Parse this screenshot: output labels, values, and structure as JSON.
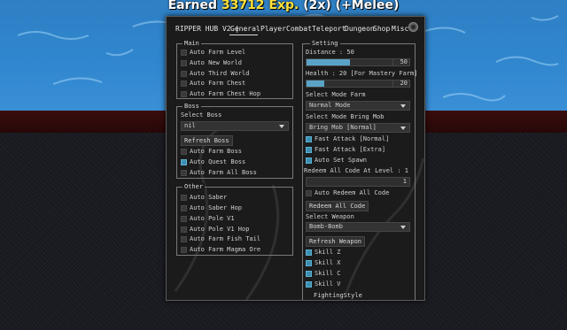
{
  "hud": {
    "earned_prefix": "Earned ",
    "earned_value": "33712 Exp.",
    "earned_suffix": " (2x) (+Melee)"
  },
  "window": {
    "title": "RIPPER HUB V2 |",
    "tabs": [
      "General",
      "Player",
      "Combat",
      "Teleport",
      "Dungeon",
      "Shop",
      "Misc"
    ],
    "active_tab": "General"
  },
  "main_group": {
    "title": "Main",
    "items": [
      {
        "label": "Auto Farm Level",
        "checked": false
      },
      {
        "label": "Auto New World",
        "checked": false
      },
      {
        "label": "Auto Third World",
        "checked": false
      },
      {
        "label": "Auto Farm Chest",
        "checked": false
      },
      {
        "label": "Auto Farm Chest Hop",
        "checked": false
      }
    ]
  },
  "boss_group": {
    "title": "Boss",
    "select_label": "Select Boss",
    "select_value": "nil",
    "refresh_label": "Refresh Boss",
    "items": [
      {
        "label": "Auto Farm Boss",
        "checked": false
      },
      {
        "label": "Auto Quest Boss",
        "checked": true
      },
      {
        "label": "Auto Farm All Boss",
        "checked": false
      }
    ]
  },
  "other_group": {
    "title": "Other",
    "items": [
      {
        "label": "Auto Saber",
        "checked": false
      },
      {
        "label": "Auto Saber Hop",
        "checked": false
      },
      {
        "label": "Auto Pole V1",
        "checked": false
      },
      {
        "label": "Auto Pole V1 Hop",
        "checked": false
      },
      {
        "label": "Auto Farm Fish Tail",
        "checked": false
      },
      {
        "label": "Auto Farm Magma Ore",
        "checked": false
      }
    ]
  },
  "setting_group": {
    "title": "Setting",
    "distance_label": "Distance : 50",
    "distance_value": "50",
    "distance_fill": 0.5,
    "health_label": "Health : 20 [For Mastery Farm]",
    "health_value": "20",
    "health_fill": 0.2,
    "mode_farm_label": "Select Mode Farm",
    "mode_farm_value": "Normal Mode",
    "mode_mob_label": "Select Mode Bring Mob",
    "mode_mob_value": "Bring Mob [Normal]",
    "toggles": [
      {
        "label": "Fast Attack [Normal]",
        "checked": true
      },
      {
        "label": "Fast Attack [Extra]",
        "checked": true
      },
      {
        "label": "Auto Set Spawn",
        "checked": true
      }
    ],
    "redeem_label": "Redeem All Code At Level : 1",
    "redeem_value": "1",
    "auto_redeem": {
      "label": "Auto Redeem All Code",
      "checked": false
    },
    "redeem_button": "Redeem All Code",
    "weapon_label": "Select Weapon",
    "weapon_value": "Bomb-Bomb",
    "refresh_weapon": "Refresh Weapon",
    "skills": [
      {
        "label": "Skill Z",
        "checked": true
      },
      {
        "label": "Skill X",
        "checked": true
      },
      {
        "label": "Skill C",
        "checked": true
      },
      {
        "label": "Skill V",
        "checked": true
      }
    ],
    "next_title": "FightingStyle"
  },
  "colors": {
    "accent": "#5aa3c6",
    "panel": "#1b1b1b",
    "exp": "#ffe13a"
  }
}
